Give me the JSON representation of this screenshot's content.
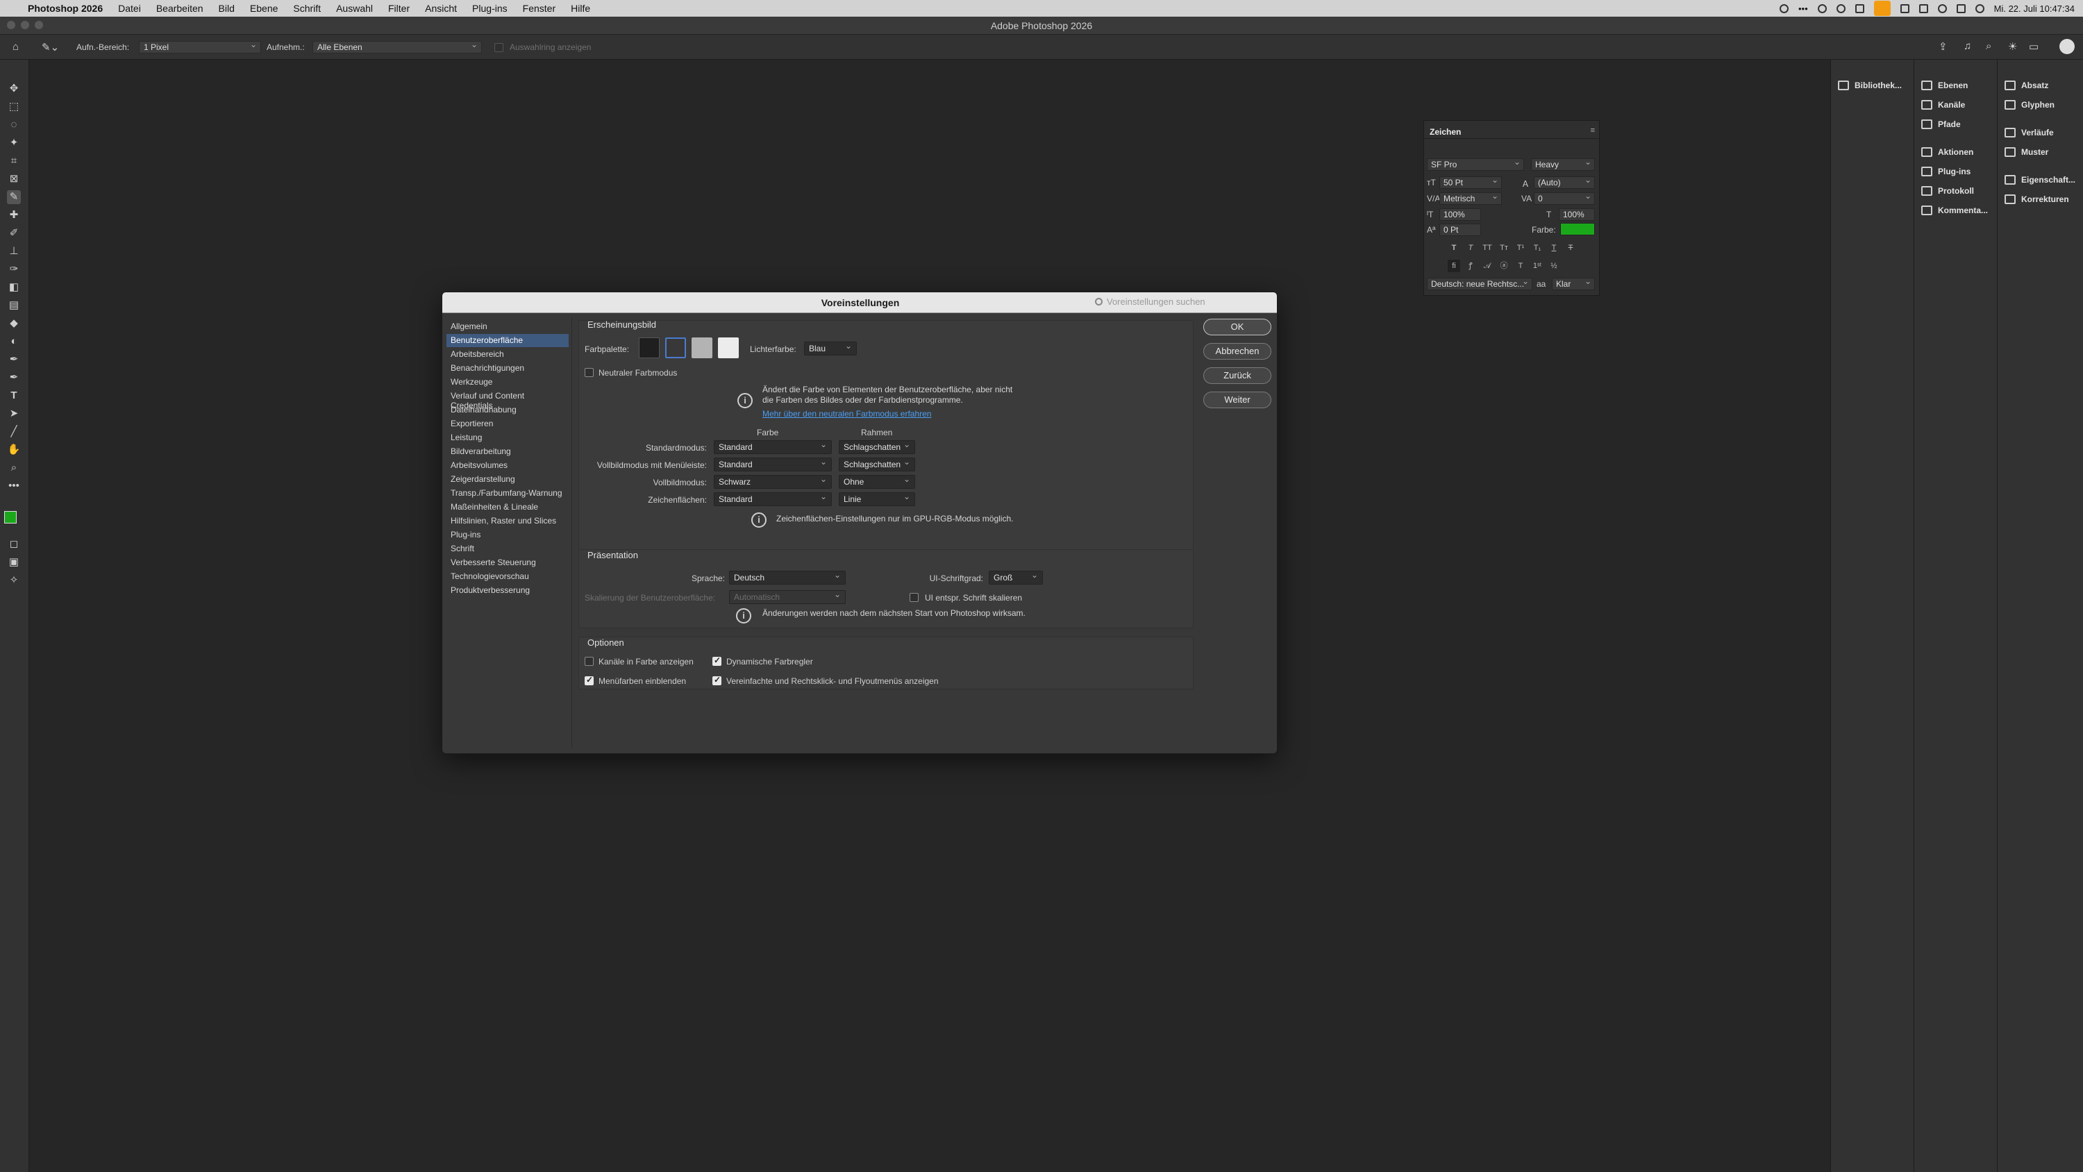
{
  "menubar": {
    "app_name": "Photoshop 2026",
    "items": [
      "Datei",
      "Bearbeiten",
      "Bild",
      "Ebene",
      "Schrift",
      "Auswahl",
      "Filter",
      "Ansicht",
      "Plug-ins",
      "Fenster",
      "Hilfe"
    ],
    "clock": "Mi. 22. Juli 10:47:34"
  },
  "window": {
    "title": "Adobe Photoshop 2026"
  },
  "options_bar": {
    "sample_size_label": "Aufn.-Bereich:",
    "sample_size_value": "1 Pixel",
    "sample_label": "Aufnehm.:",
    "sample_value": "Alle Ebenen",
    "show_ring_label": "Auswahlring anzeigen"
  },
  "right_panels": {
    "col1": [
      {
        "label": "Bibliothek...",
        "icon": "library-icon"
      }
    ],
    "col2": [
      {
        "label": "Ebenen",
        "icon": "layers-icon"
      },
      {
        "label": "Kanäle",
        "icon": "channels-icon"
      },
      {
        "label": "Pfade",
        "icon": "paths-icon"
      },
      {
        "label": "Aktionen",
        "icon": "actions-icon"
      },
      {
        "label": "Plug-ins",
        "icon": "plugins-icon"
      },
      {
        "label": "Protokoll",
        "icon": "history-icon"
      },
      {
        "label": "Kommenta...",
        "icon": "comments-icon"
      }
    ],
    "col3": [
      {
        "label": "Absatz",
        "icon": "paragraph-icon"
      },
      {
        "label": "Glyphen",
        "icon": "glyphs-icon"
      },
      {
        "label": "Verläufe",
        "icon": "gradients-icon"
      },
      {
        "label": "Muster",
        "icon": "patterns-icon"
      },
      {
        "label": "Eigenschaft...",
        "icon": "properties-icon"
      },
      {
        "label": "Korrekturen",
        "icon": "adjustments-icon"
      }
    ]
  },
  "zeichen": {
    "title": "Zeichen",
    "font_family": "SF Pro",
    "font_style": "Heavy",
    "size": "50 Pt",
    "leading": "(Auto)",
    "kerning": "Metrisch",
    "tracking": "0",
    "vscale": "100%",
    "hscale": "100%",
    "baseline": "0 Pt",
    "color_label": "Farbe:",
    "color": "#1aa81a",
    "language": "Deutsch: neue Rechtsc...",
    "aa_label": "aa",
    "antialias": "Klar"
  },
  "dialog": {
    "title": "Voreinstellungen",
    "search_placeholder": "Voreinstellungen suchen",
    "categories": [
      "Allgemein",
      "Benutzeroberfläche",
      "Arbeitsbereich",
      "Benachrichtigungen",
      "Werkzeuge",
      "Verlauf und Content Credentials",
      "Dateihandhabung",
      "Exportieren",
      "Leistung",
      "Bildverarbeitung",
      "Arbeitsvolumes",
      "Zeigerdarstellung",
      "Transp./Farbumfang-Warnung",
      "Maßeinheiten & Lineale",
      "Hilfslinien, Raster und Slices",
      "Plug-ins",
      "Schrift",
      "Verbesserte Steuerung",
      "Technologievorschau",
      "Produktverbesserung"
    ],
    "selected_index": 1,
    "buttons": {
      "ok": "OK",
      "cancel": "Abbrechen",
      "back": "Zurück",
      "next": "Weiter"
    },
    "appearance": {
      "header": "Erscheinungsbild",
      "palette_label": "Farbpalette:",
      "palette_colors": [
        "#1f1f1f",
        "#383838",
        "#b3b3b3",
        "#ececec"
      ],
      "highlight_label": "Lichterfarbe:",
      "highlight_value": "Blau",
      "neutral_label": "Neutraler Farbmodus",
      "neutral_info_1": "Ändert die Farbe von Elementen der Benutzeroberfläche, aber nicht",
      "neutral_info_2": "die Farben des Bildes oder der Farbdienstprogramme.",
      "neutral_link": "Mehr über den neutralen Farbmodus erfahren",
      "col_color": "Farbe",
      "col_border": "Rahmen",
      "rows": [
        {
          "label": "Standardmodus:",
          "color": "Standard",
          "border": "Schlagschatten"
        },
        {
          "label": "Vollbildmodus mit Menüleiste:",
          "color": "Standard",
          "border": "Schlagschatten"
        },
        {
          "label": "Vollbildmodus:",
          "color": "Schwarz",
          "border": "Ohne"
        },
        {
          "label": "Zeichenflächen:",
          "color": "Standard",
          "border": "Linie"
        }
      ],
      "artboard_info": "Zeichenflächen-Einstellungen nur im GPU-RGB-Modus möglich."
    },
    "presentation": {
      "header": "Präsentation",
      "language_label": "Sprache:",
      "language_value": "Deutsch",
      "font_size_label": "UI-Schriftgrad:",
      "font_size_value": "Groß",
      "scaling_label": "Skalierung der Benutzeroberfläche:",
      "scaling_value": "Automatisch",
      "scale_font_label": "UI entspr. Schrift skalieren",
      "restart_info": "Änderungen werden nach dem nächsten Start von Photoshop wirksam."
    },
    "options": {
      "header": "Optionen",
      "channels_color": "Kanäle in Farbe anzeigen",
      "dynamic_sliders": "Dynamische Farbregler",
      "menu_colors": "Menüfarben einblenden",
      "simplified_menus": "Vereinfachte und Rechtsklick- und Flyoutmenüs anzeigen"
    }
  }
}
